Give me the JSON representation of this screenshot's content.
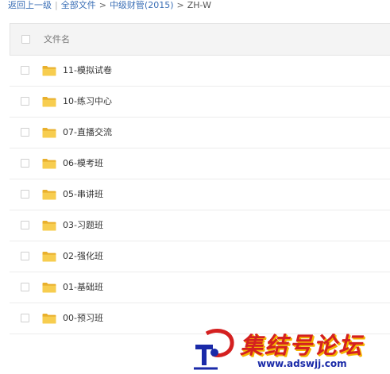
{
  "breadcrumb": {
    "back": "返回上一级",
    "all_files": "全部文件",
    "parent": "中级财管(2015)",
    "current": "ZH-W"
  },
  "list": {
    "header_label": "文件名",
    "items": [
      {
        "name": "11-模拟试卷",
        "icon": "folder-icon"
      },
      {
        "name": "10-练习中心",
        "icon": "folder-icon"
      },
      {
        "name": "07-直播交流",
        "icon": "folder-icon"
      },
      {
        "name": "06-模考班",
        "icon": "folder-icon"
      },
      {
        "name": "05-串讲班",
        "icon": "folder-icon"
      },
      {
        "name": "03-习题班",
        "icon": "folder-icon"
      },
      {
        "name": "02-强化班",
        "icon": "folder-icon"
      },
      {
        "name": "01-基础班",
        "icon": "folder-icon"
      },
      {
        "name": "00-预习班",
        "icon": "folder-icon"
      }
    ]
  },
  "watermark": {
    "title": "集结号论坛",
    "url": "www.adswjj.com"
  },
  "colors": {
    "link": "#3b6fb6",
    "header_bg": "#f4f4f4",
    "folder": "#f5c443",
    "watermark_red": "#d42020",
    "watermark_blue": "#1a2aa8"
  }
}
